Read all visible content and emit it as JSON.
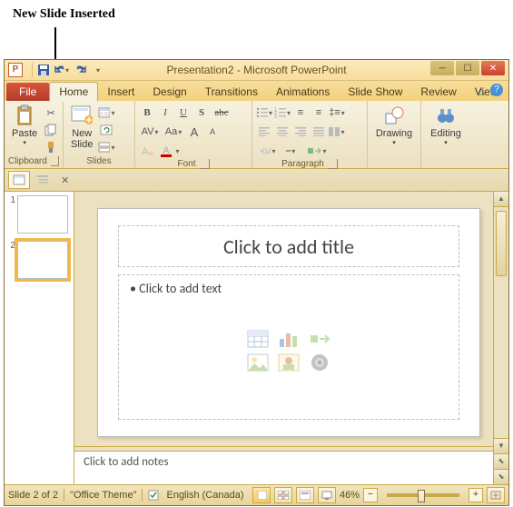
{
  "annotation": "New Slide Inserted",
  "window": {
    "title": "Presentation2 - Microsoft PowerPoint",
    "file_tab": "File",
    "tabs": [
      "Home",
      "Insert",
      "Design",
      "Transitions",
      "Animations",
      "Slide Show",
      "Review",
      "View"
    ],
    "active_tab": "Home"
  },
  "qat": {
    "save": "save-icon",
    "undo": "undo-icon",
    "redo": "redo-icon"
  },
  "ribbon": {
    "clipboard": {
      "label": "Clipboard",
      "paste": "Paste"
    },
    "slides": {
      "label": "Slides",
      "new_slide": "New\nSlide"
    },
    "font": {
      "label": "Font",
      "buttons": [
        "B",
        "I",
        "U",
        "S",
        "abc",
        "AV",
        "Aa",
        "A",
        "A"
      ]
    },
    "paragraph": {
      "label": "Paragraph"
    },
    "drawing": {
      "label": "Drawing"
    },
    "editing": {
      "label": "Editing"
    }
  },
  "thumbnails": [
    {
      "num": "1",
      "selected": false
    },
    {
      "num": "2",
      "selected": true
    }
  ],
  "slide": {
    "title_placeholder": "Click to add title",
    "content_placeholder": "Click to add text"
  },
  "notes_placeholder": "Click to add notes",
  "status": {
    "slide_info": "Slide 2 of 2",
    "theme": "\"Office Theme\"",
    "language": "English (Canada)",
    "zoom": "46%"
  }
}
